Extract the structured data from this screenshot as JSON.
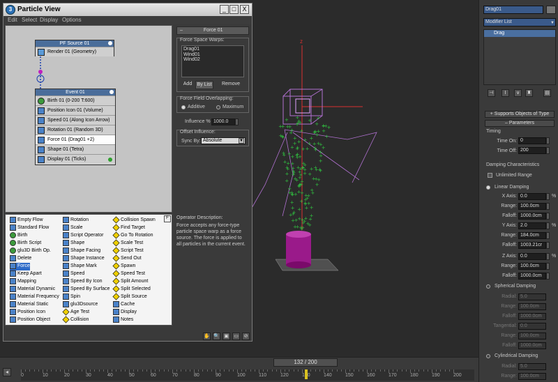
{
  "window": {
    "title": "Particle View",
    "menu": [
      "Edit",
      "Select",
      "Display",
      "Options"
    ],
    "controls": [
      "_",
      "□",
      "X"
    ]
  },
  "graph": {
    "source_node": {
      "title": "PF Source 01",
      "operators": [
        "Render 01 (Geometry)"
      ]
    },
    "event_node": {
      "title": "Event 01",
      "operators": [
        "Birth 01 (0-200 T:600)",
        "Position Icon 01 (Volume)",
        "Speed 01 (Along Icon Arrow)",
        "Rotation 01 (Random 3D)",
        "Force 01 (Drag01 +2)",
        "Shape 01 (Tetra)",
        "Display 01 (Ticks)"
      ]
    }
  },
  "force_panel": {
    "title": "Force 01",
    "group_label": "Force Space Warps:",
    "warps": [
      "Drag01",
      "Wind01",
      "Wind02"
    ],
    "add_label": "Add",
    "by_list_label": "By List",
    "remove_label": "Remove",
    "overlap_label": "Force Field Overlapping:",
    "additive_label": "Additive",
    "maximum_label": "Maximum",
    "influence_label": "Influence %",
    "influence_value": "1000.0",
    "offset_label": "Offset Influence:",
    "sync_label": "Sync By:",
    "sync_value": "Absolute"
  },
  "depot": {
    "col1": [
      "Empty Flow",
      "Standard Flow",
      "Birth",
      "Birth Script",
      "glu3D Birth Op.",
      "Delete",
      "Force",
      "Keep Apart",
      "Mapping",
      "Material Dynamic",
      "Material Frequency",
      "Material Static",
      "Position Icon",
      "Position Object"
    ],
    "col2": [
      "Rotation",
      "Scale",
      "Script Operator",
      "Shape",
      "Shape Facing",
      "Shape Instance",
      "Shape Mark",
      "Speed",
      "Speed By Icon",
      "Speed By Surface",
      "Spin",
      "glu3Dsource",
      "Age Test",
      "Collision"
    ],
    "col3": [
      "Collision Spawn",
      "Find Target",
      "Go To Rotation",
      "Scale Test",
      "Script Test",
      "Send Out",
      "Spawn",
      "Speed Test",
      "Split Amount",
      "Split Selected",
      "Split Source",
      "Cache",
      "Display",
      "Notes"
    ],
    "selected": "Force"
  },
  "description": {
    "title": "Operator Description:",
    "text": "Force accepts any force-type particle space warp as a force source. The force is applied to all particles in the current event."
  },
  "viewport": {
    "axis_label": "z"
  },
  "command_panel": {
    "object_name": "Drag01",
    "modifier_list": "Modifier List",
    "stack_item": "Drag",
    "supports_label": "Supports Objects of Type",
    "parameters_label": "Parameters",
    "timing_label": "Timing",
    "time_on_label": "Time On:",
    "time_on": "0",
    "time_off_label": "Time Off:",
    "time_off": "200",
    "damping_label": "Damping Characteristics",
    "unlimited_label": "Unlimited Range",
    "linear_label": "Linear Damping",
    "x_axis_label": "X Axis:",
    "x_axis": "0.0",
    "range_label": "Range:",
    "x_range": "100.0cm",
    "falloff_label": "Falloff:",
    "x_falloff": "1000.0cm",
    "y_axis_label": "Y Axis:",
    "y_axis": "2.0",
    "y_range": "184.0cm",
    "y_falloff": "1003.21cr",
    "z_axis_label": "Z Axis:",
    "z_axis": "0.0",
    "z_range": "100.0cm",
    "z_falloff": "1000.0cm",
    "percent": "%",
    "spherical_label": "Spherical Damping",
    "radial_label": "Radial:",
    "radial": "5.0",
    "s_range": "100.0cm",
    "s_falloff": "1000.0cm",
    "tangential_label": "Tangential:",
    "tangential": "0.0",
    "t_range": "100.0cm",
    "t_falloff": "1000.0cm",
    "cylindrical_label": "Cylindrical Damping",
    "c_radial": "5.0",
    "c_range": "100.0cm"
  },
  "timeline": {
    "slider_label": "132 / 200",
    "current_frame": 132,
    "total_frames": 200,
    "ticks": [
      "0",
      "10",
      "20",
      "30",
      "40",
      "50",
      "60",
      "70",
      "80",
      "90",
      "100",
      "110",
      "120",
      "130",
      "140",
      "150",
      "160",
      "170",
      "180",
      "190",
      "200"
    ]
  },
  "colors": {
    "accent": "#2e6bc8",
    "particles": "#30c040",
    "space_warp": "#b070d0",
    "emitter": "#9a1a8a"
  }
}
